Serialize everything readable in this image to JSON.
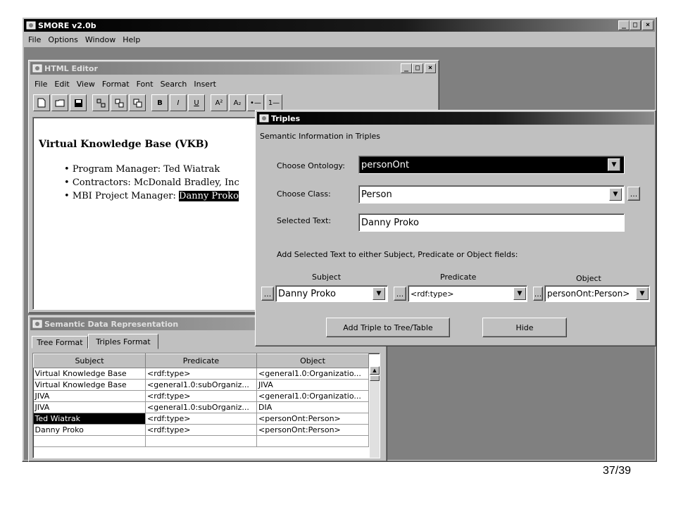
{
  "app": {
    "title": "SMORE v2.0b",
    "menu": [
      "File",
      "Options",
      "Window",
      "Help"
    ]
  },
  "html_editor": {
    "title": "HTML Editor",
    "menu": [
      "File",
      "Edit",
      "View",
      "Format",
      "Font",
      "Search",
      "Insert"
    ],
    "toolbar_labels": {
      "bold": "B",
      "italic": "I",
      "underline": "U",
      "sup": "A²",
      "sub": "A₂",
      "ul": "•—",
      "ol": "1—"
    },
    "doc_heading": "Virtual Knowledge Base (VKB)",
    "bullets": [
      {
        "text": "Program Manager: Ted Wiatrak"
      },
      {
        "text": "Contractors: McDonald Bradley, Inc"
      },
      {
        "prefix": "MBI Project Manager: ",
        "highlight": "Danny Proko"
      }
    ]
  },
  "semantic_panel": {
    "title": "Semantic Data Representation",
    "tabs": [
      "Tree Format",
      "Triples Format"
    ],
    "active_tab": 1,
    "columns": [
      "Subject",
      "Predicate",
      "Object"
    ],
    "rows": [
      [
        "Virtual Knowledge Base",
        "<rdf:type>",
        "<general1.0:Organizatio..."
      ],
      [
        "Virtual Knowledge Base",
        "<general1.0:subOrganiz...",
        "JIVA"
      ],
      [
        "JIVA",
        "<rdf:type>",
        "<general1.0:Organizatio..."
      ],
      [
        "JIVA",
        "<general1.0:subOrganiz...",
        "DIA"
      ],
      [
        "Ted Wiatrak",
        "<rdf:type>",
        "<personOnt:Person>"
      ],
      [
        "Danny Proko",
        "<rdf:type>",
        "<personOnt:Person>"
      ],
      [
        "",
        "",
        ""
      ]
    ],
    "selected_row": 4
  },
  "triples": {
    "title": "Triples",
    "subtitle": "Semantic Information in Triples",
    "ontology_label": "Choose Ontology:",
    "ontology_value": "personOnt",
    "class_label": "Choose Class:",
    "class_value": "Person",
    "selected_label": "Selected Text:",
    "selected_value": "Danny Proko",
    "instruction": "Add Selected Text to either Subject, Predicate or Object fields:",
    "subject_label": "Subject",
    "predicate_label": "Predicate",
    "object_label": "Object",
    "subject_value": "Danny Proko",
    "predicate_value": "<rdf:type>",
    "object_value": "personOnt:Person>",
    "ellipsis": "...",
    "add_button": "Add Triple to Tree/Table",
    "hide_button": "Hide"
  },
  "page_number": "37/39"
}
